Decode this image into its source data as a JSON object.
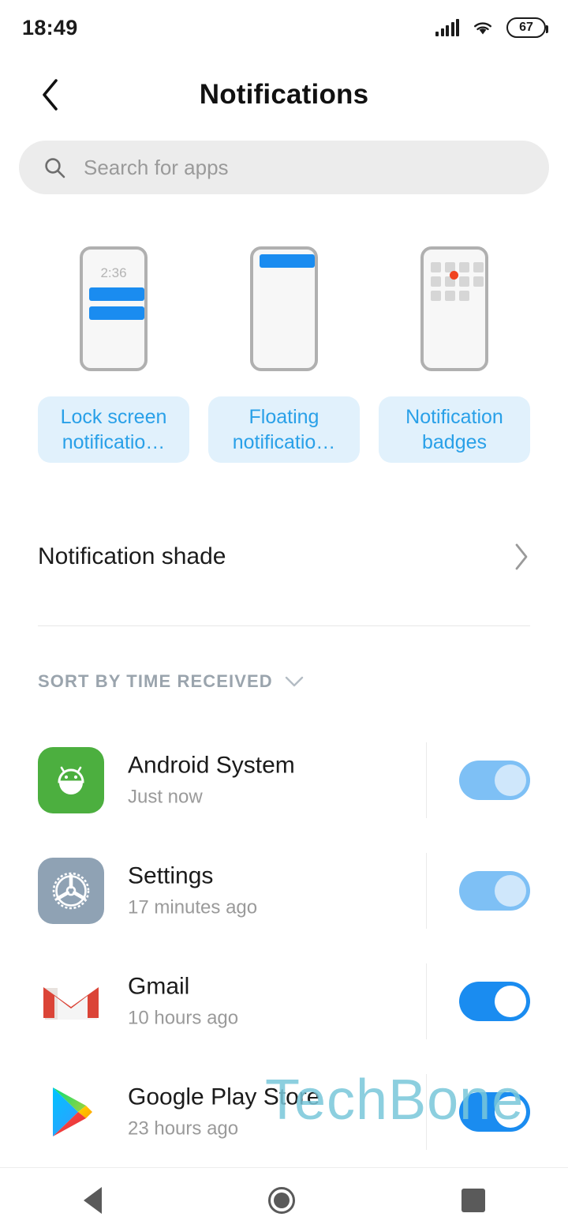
{
  "status_bar": {
    "time": "18:49",
    "battery_level": "67",
    "icons": [
      "signal-icon",
      "wifi-icon",
      "battery-icon"
    ]
  },
  "header": {
    "title": "Notifications",
    "back_icon": "chevron-left-icon"
  },
  "search": {
    "placeholder": "Search for apps",
    "value": "",
    "icon": "search-icon"
  },
  "feature_cards": [
    {
      "label": "Lock screen notificatio…",
      "preview": "lock-screen-phone-preview",
      "clock": "2:36"
    },
    {
      "label": "Floating notificatio…",
      "preview": "floating-banner-phone-preview",
      "clock": ""
    },
    {
      "label": "Notification badges",
      "preview": "app-grid-badge-phone-preview",
      "clock": ""
    }
  ],
  "shade_row": {
    "label": "Notification shade",
    "chevron_icon": "chevron-right-icon"
  },
  "sort": {
    "label": "SORT BY TIME RECEIVED",
    "chevron_icon": "chevron-down-icon"
  },
  "apps": [
    {
      "name": "Android System",
      "time": "Just now",
      "icon": "android-system-icon",
      "toggle_on": true,
      "toggle_state": "faded"
    },
    {
      "name": "Settings",
      "time": "17 minutes ago",
      "icon": "settings-gear-icon",
      "toggle_on": true,
      "toggle_state": "faded"
    },
    {
      "name": "Gmail",
      "time": "10 hours ago",
      "icon": "gmail-icon",
      "toggle_on": true,
      "toggle_state": "active"
    },
    {
      "name": "Google Play Store",
      "time": "23 hours ago",
      "icon": "play-store-icon",
      "toggle_on": true,
      "toggle_state": "active"
    }
  ],
  "watermark": {
    "text": "TechBone"
  },
  "nav_bar": {
    "back": "back-triangle-icon",
    "home": "home-circle-icon",
    "recents": "recents-square-icon"
  },
  "colors": {
    "accent_blue": "#1a8cf0",
    "chip_bg": "#e1f1fc",
    "chip_text": "#29a0e8",
    "toggle_faded": "#7ec0f5",
    "badge_red": "#f0441f",
    "android_green": "#4caf3f",
    "settings_gray": "#8fa2b4",
    "watermark": "#79c7da"
  }
}
